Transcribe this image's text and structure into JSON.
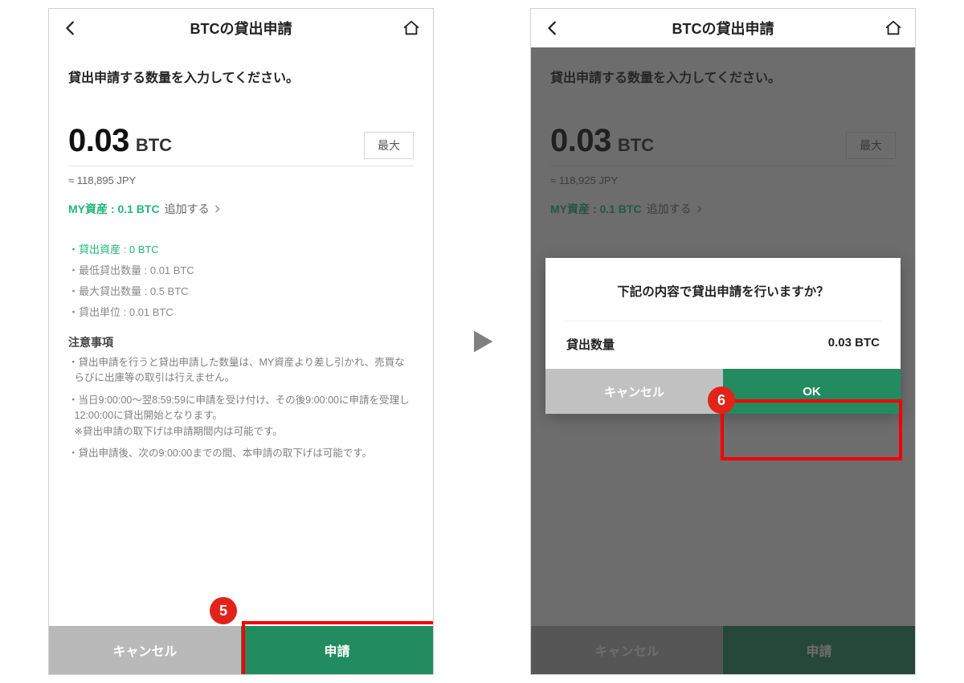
{
  "left": {
    "header": {
      "title": "BTCの貸出申請"
    },
    "prompt": "貸出申請する数量を入力してください。",
    "amount": {
      "value": "0.03",
      "unit": "BTC"
    },
    "max_btn": "最大",
    "approx": "≈ 118,895 JPY",
    "myasset_label": "MY資産 : 0.1 BTC",
    "add_link": "追加する",
    "limits": {
      "lent_asset": "貸出資産 : 0 BTC",
      "min": "最低貸出数量 : 0.01 BTC",
      "max": "最大貸出数量 : 0.5 BTC",
      "step": "貸出単位 : 0.01 BTC"
    },
    "notes_heading": "注意事項",
    "notes": [
      "貸出申請を行うと貸出申請した数量は、MY資産より差し引かれ、売買ならびに出庫等の取引は行えません。",
      "当日9:00:00～翌8:59:59に申請を受け付け、その後9:00:00に申請を受理し12:00:00に貸出開始となります。\n※貸出申請の取下げは申請期間内は可能です。",
      "貸出申請後、次の9:00:00までの間、本申請の取下げは可能です。"
    ],
    "footer": {
      "cancel": "キャンセル",
      "submit": "申請"
    },
    "step_badge": "5"
  },
  "right": {
    "header": {
      "title": "BTCの貸出申請"
    },
    "prompt": "貸出申請する数量を入力してください。",
    "amount": {
      "value": "0.03",
      "unit": "BTC"
    },
    "max_btn": "最大",
    "approx": "≈ 118,925 JPY",
    "myasset_label": "MY資産 : 0.1 BTC",
    "add_link": "追加する",
    "footer": {
      "cancel": "キャンセル",
      "submit": "申請"
    },
    "modal": {
      "title": "下記の内容で貸出申請を行いますか？",
      "qty_label": "貸出数量",
      "qty_value": "0.03 BTC",
      "cancel": "キャンセル",
      "ok": "OK"
    },
    "step_badge": "6"
  }
}
